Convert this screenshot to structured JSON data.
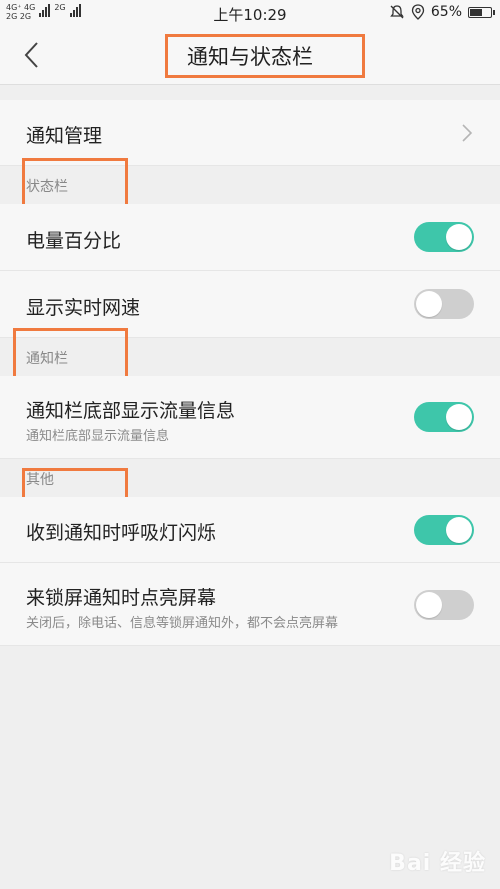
{
  "status_bar": {
    "network_top": "4G⁺ 4G",
    "network_bottom": "2G 2G",
    "network_right": "2G",
    "time": "上午10:29",
    "battery": "65%",
    "battery_level": 0.65
  },
  "header": {
    "title": "通知与状态栏",
    "back_icon": "chevron-left-icon"
  },
  "rows": {
    "notification_management": {
      "label": "通知管理"
    },
    "battery_percentage": {
      "label": "电量百分比",
      "enabled": true
    },
    "realtime_speed": {
      "label": "显示实时网速",
      "enabled": false
    },
    "traffic_info": {
      "label": "通知栏底部显示流量信息",
      "sub": "通知栏底部显示流量信息",
      "enabled": true
    },
    "breathing_light": {
      "label": "收到通知时呼吸灯闪烁",
      "enabled": true
    },
    "wake_screen": {
      "label": "来锁屏通知时点亮屏幕",
      "sub": "关闭后，除电话、信息等锁屏通知外，都不会点亮屏幕",
      "enabled": false
    }
  },
  "sections": {
    "status_bar": "状态栏",
    "notification_bar": "通知栏",
    "other": "其他"
  },
  "colors": {
    "toggle_on": "#3ec6aa",
    "toggle_off": "#cfcfcf",
    "highlight_frame": "#f07a3f"
  },
  "watermark": "Bai 经验"
}
